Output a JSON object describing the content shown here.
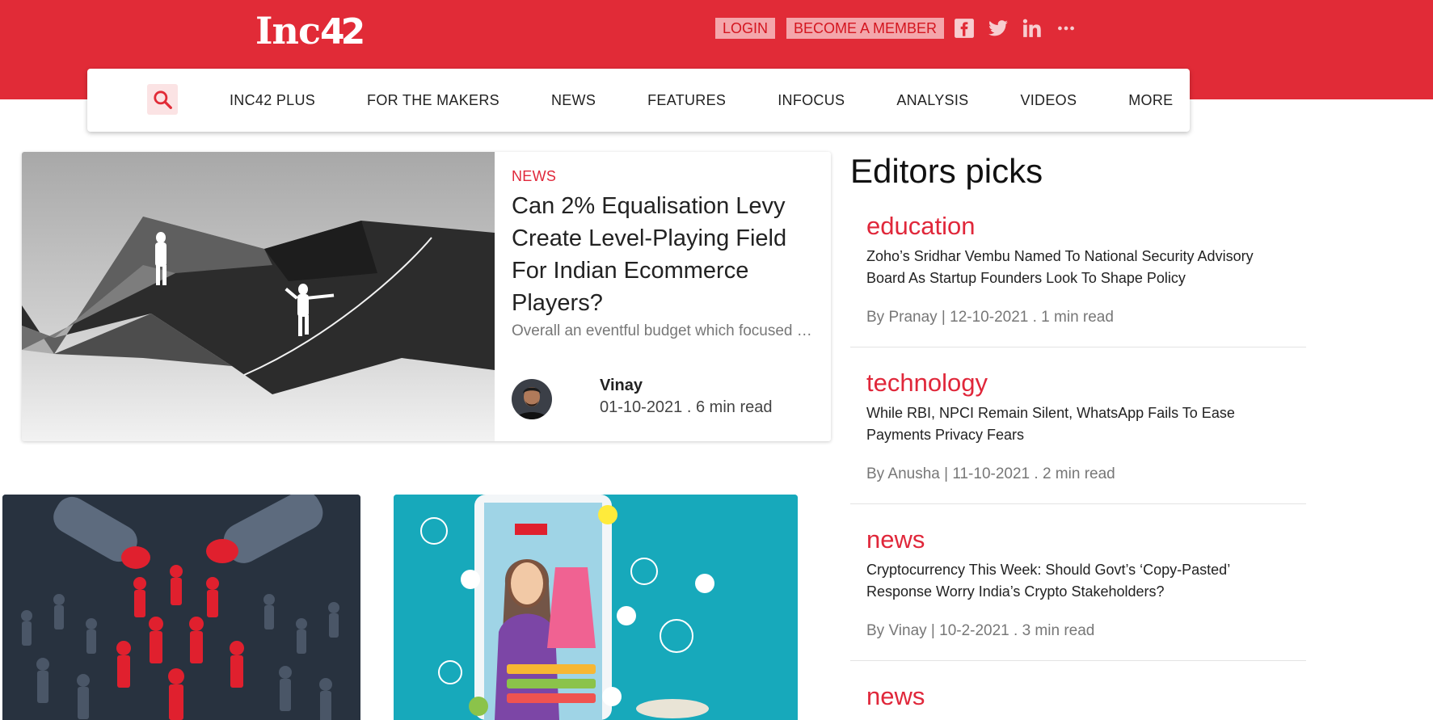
{
  "header": {
    "logo_text": "Inc",
    "logo_num": "42",
    "login_label": "LOGIN",
    "member_label": "BECOME A MEMBER"
  },
  "nav": {
    "items": [
      "INC42 PLUS",
      "FOR THE MAKERS",
      "NEWS",
      "FEATURES",
      "INFOCUS",
      "ANALYSIS",
      "VIDEOS",
      "MORE"
    ]
  },
  "feature": {
    "category": "NEWS",
    "title": "Can 2% Equalisation Levy Create Level-Playing Field For Indian Ecommerce Players?",
    "excerpt": "Overall an eventful budget which focused on enabling the ecosystem",
    "author": "Vinay",
    "meta": "01-10-2021 . 6 min read"
  },
  "editors": {
    "title": "Editors picks",
    "picks": [
      {
        "category": "education",
        "title": "Zoho’s Sridhar Vembu Named To National Security Advisory Board As Startup Founders Look To Shape Policy",
        "meta": "By Pranay | 12-10-2021 . 1 min read"
      },
      {
        "category": "technology",
        "title": "While RBI, NPCI Remain Silent, WhatsApp Fails To Ease Payments Privacy Fears",
        "meta": "By Anusha | 11-10-2021 . 2 min read"
      },
      {
        "category": "news",
        "title": "Cryptocurrency This Week: Should Govt’s ‘Copy-Pasted’ Response Worry India’s Crypto Stakeholders?",
        "meta": "By Vinay | 10-2-2021 . 3 min read"
      },
      {
        "category": "news",
        "title": "",
        "meta": ""
      }
    ]
  },
  "icons": {
    "search": "search-icon",
    "facebook": "facebook-icon",
    "twitter": "twitter-icon",
    "linkedin": "linkedin-icon",
    "more": "more-dots-icon"
  },
  "colors": {
    "brand": "#e12b37",
    "accent_text": "#e0273a",
    "button_bg": "#f4a6ab"
  }
}
